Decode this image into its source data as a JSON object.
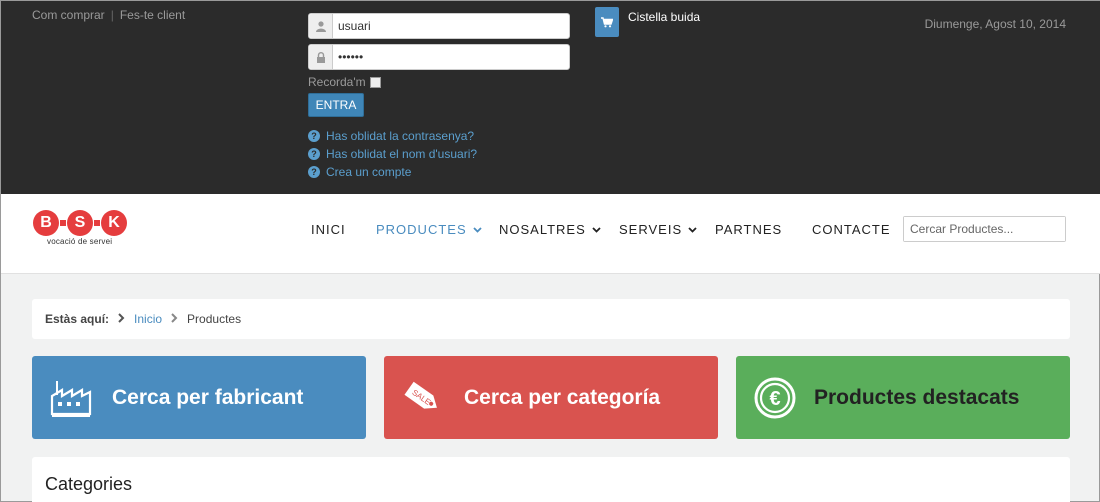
{
  "top": {
    "links": [
      "Com comprar",
      "Fes-te client"
    ],
    "separator": "|",
    "login": {
      "username_value": "usuari",
      "password_value": "••••••",
      "remember_label": "Recorda'm",
      "submit_label": "ENTRA"
    },
    "help_links": [
      "Has oblidat la contrasenya?",
      "Has oblidat el nom d'usuari?",
      "Crea un compte"
    ],
    "cart_label": "Cistella buida",
    "date": "Diumenge, Agost 10, 2014"
  },
  "logo": {
    "letters": [
      "B",
      "S",
      "K"
    ],
    "tagline": "vocació de servei"
  },
  "nav": {
    "items": [
      {
        "label": "INICI"
      },
      {
        "label": "PRODUCTES"
      },
      {
        "label": "NOSALTRES"
      },
      {
        "label": "SERVEIS"
      },
      {
        "label": "PARTNES"
      },
      {
        "label": "CONTACTE"
      }
    ],
    "chevron": "⌄",
    "search_placeholder": "Cercar Productes..."
  },
  "breadcrumb": {
    "label": "Estàs aquí:",
    "items": [
      "Inicio",
      "Productes"
    ]
  },
  "cards": [
    {
      "title": "Cerca per fabricant",
      "icon": "factory-icon",
      "color": "#4a8cbf"
    },
    {
      "title": "Cerca per categoría",
      "icon": "sale-tag-icon",
      "color": "#d9534f",
      "tag_text": "SALE"
    },
    {
      "title": "Productes destacats",
      "icon": "euro-icon",
      "color": "#5aae5b",
      "symbol": "€"
    }
  ],
  "categories_title": "Categories"
}
